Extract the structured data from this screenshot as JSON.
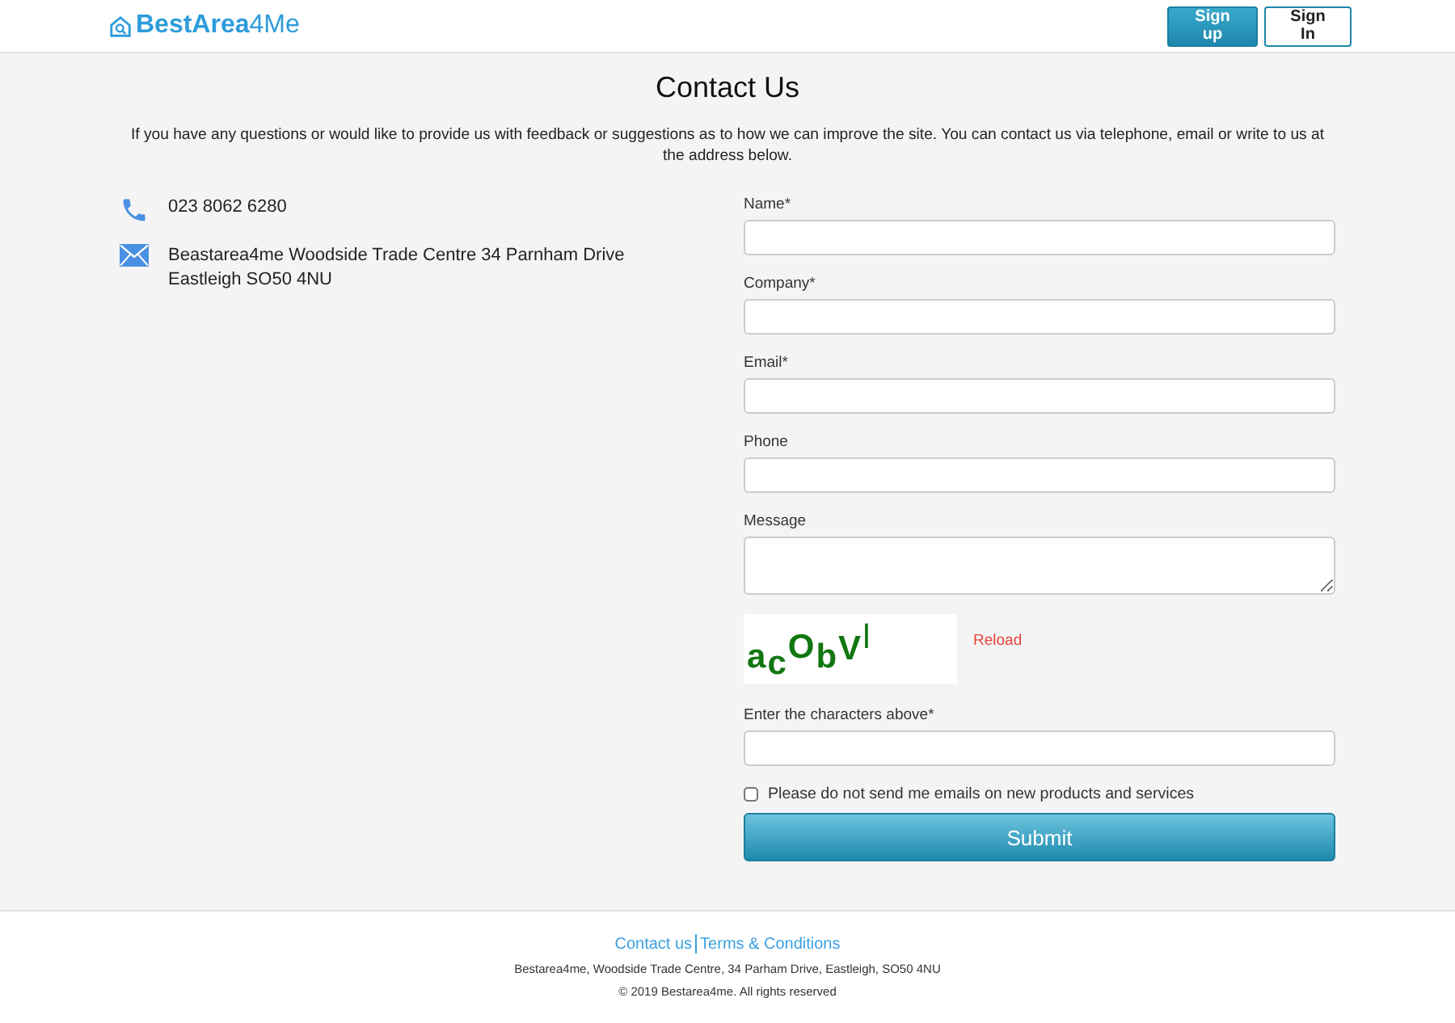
{
  "header": {
    "logo": "**BestArea**4Me",
    "buttons": [
      {
        "label": "Sign up",
        "kind": "primary"
      },
      {
        "label": "Sign In",
        "kind": "outline"
      }
    ]
  },
  "title": "Contact Us",
  "intro": "If you have any questions or would like to provide us with feedback or suggestions as to how we can improve the site. You can contact us via telephone, email or write to us at the address below.",
  "contacts": [
    {
      "kind": "phone",
      "text": "023 8062 6280"
    },
    {
      "kind": "mail",
      "text": "Beastarea4me Woodside Trade Centre 34 Parnham Drive Eastleigh SO50 4NU"
    }
  ],
  "form": {
    "fields": [
      {
        "label": "Name*",
        "kind": "input"
      },
      {
        "label": "Company*",
        "kind": "input"
      },
      {
        "label": "Email*",
        "kind": "input"
      },
      {
        "label": "Phone",
        "kind": "input"
      },
      {
        "label": "Message",
        "kind": "textarea"
      }
    ],
    "captcha": {
      "characters": [
        "a",
        "c",
        "O",
        "b",
        "V",
        "l"
      ],
      "reload": "Reload",
      "label": "Enter the characters above*"
    },
    "opt_out": {
      "label": "Please do not send me emails on new products and services",
      "checked": false
    },
    "submit": "Submit"
  },
  "footer": {
    "links": [
      "Contact us",
      "Terms & Conditions"
    ],
    "address": "Bestarea4me, Woodside Trade Centre, 34 Parham Drive, Eastleigh, SO50 4NU",
    "copyright": "© 2019 Bestarea4me. All rights reserved"
  }
}
